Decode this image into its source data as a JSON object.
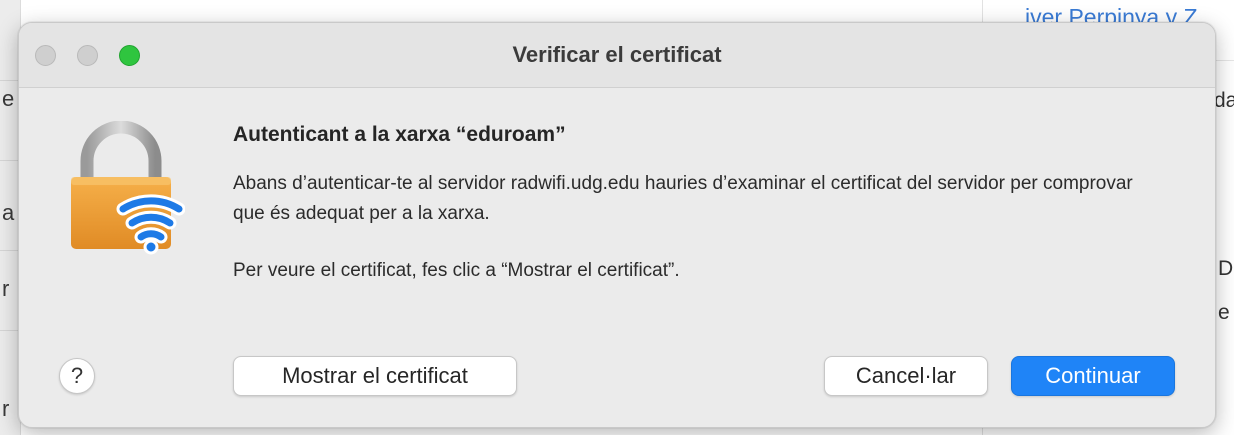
{
  "background": {
    "left_fragments": [
      "e",
      "a",
      "r",
      "r"
    ],
    "right_link": "iver Perpinya y Z",
    "right_fragments": [
      "da",
      "D",
      "e"
    ]
  },
  "dialog": {
    "title": "Verificar el certificat",
    "heading": "Autenticant a la xarxa “eduroam”",
    "paragraph1": "Abans d’autenticar-te al servidor radwifi.udg.edu hauries d’examinar el certificat del servidor per comprovar que és adequat per a la xarxa.",
    "paragraph2": "Per veure el certificat, fes clic a “Mostrar el certificat”.",
    "help_label": "?",
    "buttons": {
      "show_certificate": "Mostrar el certificat",
      "cancel": "Cancel·lar",
      "continue": "Continuar"
    },
    "icon": "lock-wifi-icon"
  },
  "colors": {
    "accent": "#1f84f7",
    "zoom_button": "#2fc53f",
    "lock_body": "#f0a23a",
    "wifi": "#1e7ae6"
  }
}
